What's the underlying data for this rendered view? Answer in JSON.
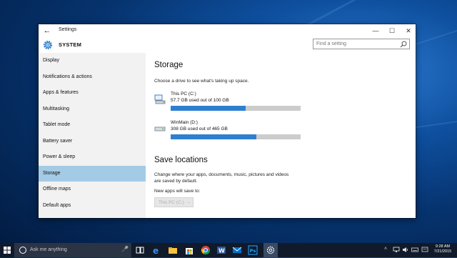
{
  "window": {
    "title": "Settings",
    "back_glyph": "←",
    "minimize_glyph": "—",
    "maximize_glyph": "☐",
    "close_glyph": "✕"
  },
  "header": {
    "section": "SYSTEM",
    "search_placeholder": "Find a setting"
  },
  "sidebar": {
    "items": [
      {
        "label": "Display",
        "active": false
      },
      {
        "label": "Notifications & actions",
        "active": false
      },
      {
        "label": "Apps & features",
        "active": false
      },
      {
        "label": "Multitasking",
        "active": false
      },
      {
        "label": "Tablet mode",
        "active": false
      },
      {
        "label": "Battery saver",
        "active": false
      },
      {
        "label": "Power & sleep",
        "active": false
      },
      {
        "label": "Storage",
        "active": true
      },
      {
        "label": "Offline maps",
        "active": false
      },
      {
        "label": "Default apps",
        "active": false
      }
    ]
  },
  "main": {
    "title": "Storage",
    "description": "Choose a drive to see what's taking up space.",
    "drives": [
      {
        "name": "This PC (C:)",
        "usage": "57.7 GB used out of 100 GB",
        "fraction": 0.577
      },
      {
        "name": "WinMain (D:)",
        "usage": "308 GB used out of 465 GB",
        "fraction": 0.662
      }
    ],
    "save_locations": {
      "title": "Save locations",
      "description_line1": "Change where your apps, documents, music, pictures and videos",
      "description_line2": "are saved by default.",
      "new_apps_label": "New apps will save to:",
      "new_apps_value": "This PC (C:)"
    }
  },
  "taskbar": {
    "search_placeholder": "Ask me anything",
    "clock_time": "9:28 AM",
    "clock_date": "7/21/2015"
  },
  "colors": {
    "accent": "#2f7fcf",
    "selection": "#a3cbe6",
    "bar_track": "#cccccc"
  }
}
